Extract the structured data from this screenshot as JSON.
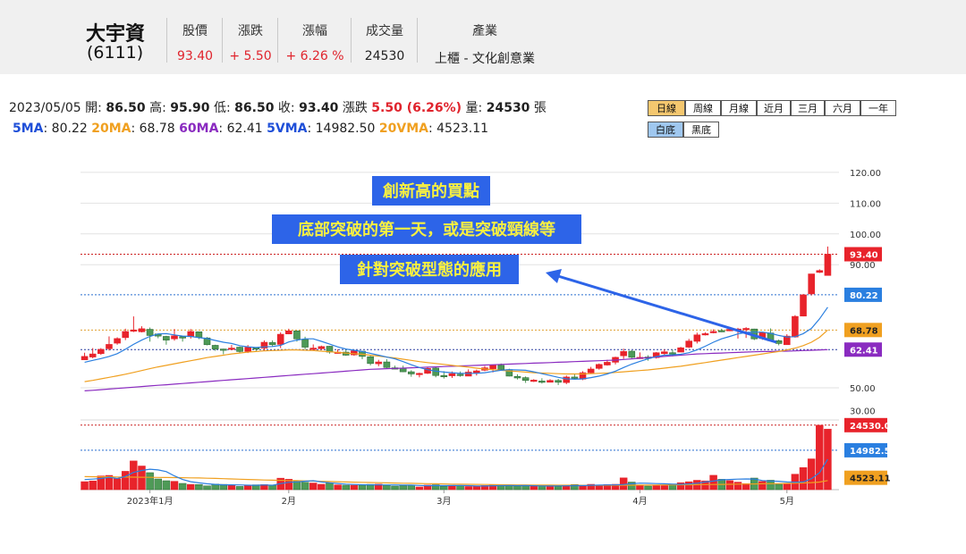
{
  "header": {
    "name": "大宇資",
    "code": "(6111)",
    "columns": [
      {
        "title": "股價",
        "value": "93.40",
        "color": "#e0242d"
      },
      {
        "title": "漲跌",
        "value": "+ 5.50",
        "color": "#e0242d"
      },
      {
        "title": "漲幅",
        "value": "+ 6.26 %",
        "color": "#e0242d"
      },
      {
        "title": "成交量",
        "value": "24530",
        "color": "#222222"
      },
      {
        "title": "產業",
        "value": "上櫃 - 文化創意業",
        "color": "#222222"
      }
    ]
  },
  "info": {
    "date": "2023/05/05",
    "open_label": "開:",
    "open": "86.50",
    "high_label": "高:",
    "high": "95.90",
    "low_label": "低:",
    "low": "86.50",
    "close_label": "收:",
    "close": "93.40",
    "chg_label": "漲跌",
    "chg": "5.50 (6.26%)",
    "vol_label": "量:",
    "vol": "24530",
    "vol_unit": "張",
    "ma5_label": "5MA",
    "ma5": ": 80.22",
    "ma20_label": "20MA",
    "ma20": ": 68.78",
    "ma60_label": "60MA",
    "ma60": ": 62.41",
    "vma5_label": "5VMA",
    "vma5": ": 14982.50",
    "vma20_label": "20VMA",
    "vma20": ": 4523.11"
  },
  "buttons": {
    "periods": [
      "日線",
      "周線",
      "月線",
      "近月",
      "三月",
      "六月",
      "一年"
    ],
    "themes": [
      "白底",
      "黑底"
    ]
  },
  "colors": {
    "up": "#e8232b",
    "down": "#4e9a57",
    "ma5": "#2a7fe0",
    "ma20": "#f0a020",
    "ma60": "#8a2bc0",
    "annotation_bg": "#2d64e8",
    "annotation_text": "#f8f040"
  },
  "annotations": [
    "創新高的買點",
    "底部突破的第一天，或是突破頸線等",
    "針對突破型態的應用"
  ],
  "chart_data": {
    "type": "candlestick",
    "price_axis": {
      "ticks": [
        "120.00",
        "110.00",
        "100.00",
        "90.00",
        "50.00"
      ],
      "values": [
        120,
        110,
        100,
        90,
        50
      ],
      "range": [
        41,
        122
      ]
    },
    "volume_axis": {
      "ticks": [
        "30.00"
      ],
      "values": [
        30
      ],
      "range": [
        0,
        26500
      ]
    },
    "x_labels": [
      "2023年1月",
      "2月",
      "3月",
      "4月",
      "5月"
    ],
    "x_label_positions": [
      8,
      25,
      44,
      68,
      86
    ],
    "n": 92,
    "candles": [
      [
        59.1,
        61.4,
        59.1,
        60.2,
        15.9
      ],
      [
        60.0,
        62.9,
        59.6,
        61.0,
        17.3
      ],
      [
        61.1,
        62.9,
        60.7,
        62.5,
        27.2
      ],
      [
        62.7,
        66.7,
        62.1,
        64.1,
        28.3
      ],
      [
        64.5,
        66.4,
        64.0,
        66.0,
        21.6
      ],
      [
        66.3,
        69.2,
        65.5,
        68.3,
        36.4
      ],
      [
        68.4,
        73.2,
        68.1,
        68.8,
        56.9
      ],
      [
        68.2,
        70.0,
        68.0,
        69.2,
        46.9
      ],
      [
        69.0,
        69.6,
        65.0,
        67.0,
        33.7
      ],
      [
        67.5,
        67.5,
        66.1,
        66.8,
        21.2
      ],
      [
        66.7,
        66.9,
        64.0,
        65.5,
        17.7
      ],
      [
        65.9,
        69.1,
        65.3,
        66.9,
        16.6
      ],
      [
        66.6,
        66.7,
        65.0,
        66.2,
        12.4
      ],
      [
        66.6,
        69.1,
        66.0,
        68.3,
        10.5
      ],
      [
        68.2,
        68.3,
        65.8,
        66.4,
        10.2
      ],
      [
        66.2,
        66.5,
        63.8,
        64.0,
        7.6
      ],
      [
        63.8,
        64.0,
        62.0,
        62.6,
        11.1
      ],
      [
        62.6,
        62.7,
        60.9,
        62.3,
        10.5
      ],
      [
        62.8,
        63.9,
        62.2,
        62.9,
        8.6
      ],
      [
        63.2,
        63.4,
        61.4,
        61.8,
        6.4
      ],
      [
        61.8,
        63.9,
        61.3,
        63.2,
        7.6
      ],
      [
        63.0,
        63.2,
        61.8,
        62.9,
        9.6
      ],
      [
        62.9,
        65.4,
        61.9,
        64.8,
        10.1
      ],
      [
        64.7,
        65.4,
        63.5,
        64.0,
        9.4
      ],
      [
        64.1,
        68.0,
        62.9,
        67.4,
        22.8
      ],
      [
        67.5,
        69.2,
        67.4,
        68.5,
        20.7
      ],
      [
        68.5,
        68.6,
        65.0,
        65.9,
        17.0
      ],
      [
        65.7,
        66.6,
        62.5,
        63.2,
        14.6
      ],
      [
        62.9,
        64.1,
        62.2,
        62.9,
        13.2
      ],
      [
        62.7,
        63.7,
        62.3,
        63.4,
        10.7
      ],
      [
        63.5,
        63.6,
        61.1,
        61.6,
        13.0
      ],
      [
        61.6,
        62.5,
        61.4,
        61.6,
        9.5
      ],
      [
        61.6,
        62.4,
        60.4,
        60.6,
        8.8
      ],
      [
        60.7,
        62.2,
        60.4,
        62.0,
        8.8
      ],
      [
        61.9,
        62.0,
        59.3,
        60.2,
        9.2
      ],
      [
        60.1,
        60.4,
        57.3,
        57.9,
        10.5
      ],
      [
        57.8,
        59.1,
        57.0,
        58.4,
        10.9
      ],
      [
        58.4,
        59.3,
        56.4,
        56.6,
        9.3
      ],
      [
        56.5,
        57.2,
        56.1,
        56.3,
        7.1
      ],
      [
        56.4,
        57.2,
        55.1,
        55.2,
        8.0
      ],
      [
        55.2,
        55.7,
        53.6,
        54.5,
        9.0
      ],
      [
        54.5,
        54.9,
        53.4,
        54.7,
        5.4
      ],
      [
        54.7,
        56.8,
        54.5,
        56.3,
        9.1
      ],
      [
        56.4,
        56.9,
        53.4,
        54.0,
        9.7
      ],
      [
        54.0,
        55.4,
        53.0,
        53.9,
        6.8
      ],
      [
        53.9,
        55.3,
        53.2,
        54.6,
        8.5
      ],
      [
        54.4,
        55.3,
        53.6,
        54.0,
        8.4
      ],
      [
        53.8,
        56.0,
        53.8,
        55.1,
        6.3
      ],
      [
        54.8,
        55.9,
        54.0,
        55.5,
        6.6
      ],
      [
        55.7,
        57.1,
        55.4,
        56.5,
        8.2
      ],
      [
        56.2,
        57.4,
        55.0,
        57.3,
        9.1
      ],
      [
        57.3,
        57.9,
        55.7,
        56.0,
        7.5
      ],
      [
        55.9,
        56.2,
        53.7,
        53.8,
        7.9
      ],
      [
        53.7,
        54.4,
        52.7,
        53.2,
        7.4
      ],
      [
        53.3,
        53.7,
        51.6,
        52.4,
        7.5
      ],
      [
        52.2,
        52.8,
        51.9,
        52.5,
        8.4
      ],
      [
        52.2,
        53.1,
        51.4,
        52.0,
        7.6
      ],
      [
        51.8,
        52.8,
        51.8,
        52.4,
        7.0
      ],
      [
        52.4,
        52.9,
        50.9,
        51.8,
        6.6
      ],
      [
        51.7,
        54.0,
        51.2,
        53.5,
        8.5
      ],
      [
        53.5,
        54.5,
        52.8,
        53.2,
        10.2
      ],
      [
        52.8,
        55.4,
        52.5,
        54.9,
        7.1
      ],
      [
        54.9,
        56.8,
        54.5,
        56.1,
        10.6
      ],
      [
        56.3,
        57.9,
        55.9,
        57.6,
        8.8
      ],
      [
        57.4,
        59.1,
        57.2,
        58.3,
        10.2
      ],
      [
        58.3,
        60.1,
        57.6,
        59.9,
        10.6
      ],
      [
        60.4,
        62.7,
        59.4,
        61.8,
        23.4
      ],
      [
        61.9,
        62.2,
        59.6,
        59.9,
        15.0
      ],
      [
        59.8,
        61.5,
        59.4,
        59.9,
        8.1
      ],
      [
        60.0,
        60.6,
        58.8,
        59.9,
        7.1
      ],
      [
        59.8,
        61.6,
        59.5,
        61.4,
        8.3
      ],
      [
        61.1,
        62.5,
        60.7,
        61.7,
        8.2
      ],
      [
        61.4,
        62.4,
        60.2,
        61.2,
        11.2
      ],
      [
        61.6,
        63.3,
        61.6,
        63.0,
        13.8
      ],
      [
        63.2,
        65.9,
        62.9,
        65.2,
        15.7
      ],
      [
        65.1,
        67.9,
        64.4,
        67.2,
        18.6
      ],
      [
        67.2,
        68.0,
        67.0,
        67.6,
        17.4
      ],
      [
        67.9,
        69.0,
        67.7,
        68.3,
        28.5
      ],
      [
        68.6,
        69.2,
        68.1,
        68.3,
        20.6
      ],
      [
        68.5,
        69.8,
        68.4,
        69.0,
        17.9
      ],
      [
        69.0,
        69.5,
        66.0,
        69.1,
        14.9
      ],
      [
        69.1,
        69.7,
        66.2,
        69.3,
        12.1
      ],
      [
        69.1,
        69.2,
        65.5,
        65.9,
        23.0
      ],
      [
        66.0,
        68.0,
        65.6,
        67.9,
        16.4
      ],
      [
        67.8,
        69.3,
        65.1,
        65.3,
        18.7
      ],
      [
        65.3,
        65.7,
        63.8,
        64.4,
        10.7
      ],
      [
        64.0,
        67.4,
        64.0,
        66.8,
        11.7
      ],
      [
        66.5,
        73.6,
        66.3,
        73.2,
        30.7
      ],
      [
        73.3,
        80.5,
        73.2,
        80.2,
        43.8
      ],
      [
        80.5,
        87.0,
        80.0,
        87.0,
        61.0
      ],
      [
        87.5,
        88.5,
        87.3,
        88.1,
        127.7
      ],
      [
        86.5,
        95.9,
        86.5,
        93.4,
        120.0
      ]
    ],
    "ma5": [
      58.3,
      58.9,
      59.5,
      60.2,
      61.1,
      62.5,
      64.1,
      65.5,
      66.7,
      67.5,
      67.6,
      67.2,
      66.8,
      66.7,
      66.3,
      66.0,
      65.4,
      64.8,
      64.4,
      63.7,
      63.3,
      63.1,
      63.3,
      63.4,
      63.8,
      64.9,
      65.5,
      65.9,
      65.9,
      65.1,
      64.2,
      63.3,
      62.6,
      62.2,
      61.8,
      61.2,
      60.6,
      60.0,
      59.4,
      58.5,
      57.5,
      56.6,
      55.9,
      55.4,
      55.1,
      54.9,
      54.7,
      54.7,
      54.7,
      54.9,
      55.3,
      55.7,
      55.9,
      55.8,
      55.7,
      55.2,
      54.6,
      54.0,
      53.4,
      52.9,
      52.8,
      52.9,
      53.3,
      53.8,
      54.5,
      55.4,
      56.6,
      57.7,
      58.6,
      59.4,
      60.2,
      60.6,
      60.7,
      60.9,
      61.4,
      62.3,
      63.5,
      64.8,
      65.9,
      66.7,
      67.5,
      68.0,
      68.1,
      68.1,
      67.7,
      67.0,
      66.5,
      66.6,
      67.6,
      69.3,
      72.4,
      76.2
    ],
    "ma20": [
      52.0,
      52.4,
      52.9,
      53.4,
      53.9,
      54.4,
      55.0,
      55.6,
      56.2,
      56.8,
      57.3,
      57.8,
      58.3,
      58.8,
      59.3,
      59.8,
      60.2,
      60.6,
      61.0,
      61.3,
      61.6,
      61.8,
      62.0,
      62.1,
      62.2,
      62.3,
      62.3,
      62.2,
      62.1,
      61.9,
      61.7,
      61.5,
      61.3,
      61.1,
      60.9,
      60.6,
      60.3,
      60.0,
      59.7,
      59.3,
      58.9,
      58.5,
      58.2,
      57.9,
      57.6,
      57.3,
      57.0,
      56.7,
      56.4,
      56.1,
      55.9,
      55.7,
      55.5,
      55.3,
      55.1,
      54.9,
      54.8,
      54.7,
      54.6,
      54.5,
      54.5,
      54.5,
      54.6,
      54.7,
      54.8,
      55.0,
      55.2,
      55.4,
      55.6,
      55.8,
      56.1,
      56.4,
      56.7,
      57.0,
      57.4,
      57.8,
      58.2,
      58.6,
      59.0,
      59.4,
      59.8,
      60.2,
      60.6,
      61.0,
      61.4,
      61.8,
      62.3,
      62.9,
      63.7,
      64.8,
      66.4,
      68.78
    ],
    "ma60": [
      49.0,
      49.2,
      49.4,
      49.6,
      49.8,
      50.0,
      50.2,
      50.4,
      50.6,
      50.8,
      51.0,
      51.2,
      51.4,
      51.6,
      51.8,
      52.0,
      52.2,
      52.4,
      52.6,
      52.8,
      53.0,
      53.2,
      53.4,
      53.6,
      53.8,
      54.0,
      54.2,
      54.4,
      54.6,
      54.8,
      55.0,
      55.2,
      55.4,
      55.6,
      55.8,
      56.0,
      56.1,
      56.2,
      56.3,
      56.4,
      56.5,
      56.6,
      56.7,
      56.8,
      56.9,
      57.0,
      57.1,
      57.2,
      57.3,
      57.4,
      57.5,
      57.6,
      57.7,
      57.8,
      57.9,
      58.0,
      58.1,
      58.2,
      58.3,
      58.4,
      58.5,
      58.6,
      58.7,
      58.8,
      58.9,
      59.0,
      59.2,
      59.4,
      59.6,
      59.8,
      60.0,
      60.2,
      60.4,
      60.6,
      60.8,
      61.0,
      61.1,
      61.2,
      61.3,
      61.4,
      61.5,
      61.6,
      61.7,
      61.8,
      61.8,
      61.9,
      61.9,
      62.0,
      62.1,
      62.2,
      62.3,
      62.41
    ],
    "vma5": [
      20.0,
      20.8,
      22.2,
      24.5,
      22.1,
      26.2,
      34.1,
      38.0,
      40.6,
      39.1,
      35.7,
      27.2,
      20.2,
      15.7,
      13.5,
      11.7,
      10.4,
      9.6,
      9.6,
      9.3,
      8.8,
      8.6,
      9.3,
      8.6,
      12.1,
      14.5,
      15.4,
      16.8,
      17.7,
      15.2,
      13.7,
      12.2,
      11.0,
      10.3,
      9.7,
      9.6,
      9.4,
      9.3,
      9.4,
      9.2,
      9.1,
      8.3,
      7.8,
      8.1,
      8.0,
      8.2,
      8.3,
      7.9,
      7.3,
      7.2,
      7.7,
      8.0,
      8.2,
      7.9,
      8.1,
      7.7,
      7.4,
      7.2,
      7.5,
      7.6,
      8.0,
      7.9,
      8.6,
      9.0,
      9.4,
      9.3,
      10.3,
      11.7,
      12.9,
      12.6,
      12.0,
      11.6,
      11.0,
      10.7,
      11.4,
      12.7,
      15.2,
      17.0,
      19.4,
      20.1,
      20.8,
      21.3,
      21.0,
      18.0,
      17.2,
      16.7,
      15.2,
      14.9,
      15.3,
      21.7,
      33.6,
      60.4
    ],
    "vma20": [
      25.8,
      25.7,
      25.5,
      25.4,
      25.2,
      25.0,
      24.8,
      24.6,
      24.5,
      24.3,
      24.1,
      23.9,
      23.7,
      23.4,
      23.1,
      22.7,
      22.3,
      21.8,
      21.3,
      20.7,
      20.1,
      19.6,
      19.1,
      18.7,
      18.4,
      18.1,
      17.8,
      17.3,
      16.9,
      16.5,
      16.1,
      15.7,
      15.3,
      14.9,
      14.5,
      14.2,
      13.8,
      13.4,
      13.1,
      12.8,
      12.5,
      12.2,
      11.9,
      11.6,
      11.3,
      11.0,
      10.8,
      10.6,
      10.4,
      10.2,
      10.0,
      9.8,
      9.6,
      9.4,
      9.3,
      9.2,
      9.1,
      9.0,
      8.9,
      8.8,
      8.8,
      8.7,
      8.7,
      8.7,
      8.7,
      8.7,
      8.8,
      8.9,
      9.0,
      9.1,
      9.2,
      9.3,
      9.4,
      9.5,
      9.7,
      9.9,
      10.1,
      10.3,
      10.5,
      10.7,
      10.9,
      11.1,
      11.4,
      11.7,
      11.9,
      12.1,
      12.4,
      12.8,
      13.3,
      14.0,
      15.1,
      18.09
    ],
    "price_labels": [
      {
        "value": 93.4,
        "text": "93.40",
        "color": "#e8232b"
      },
      {
        "value": 80.22,
        "text": "80.22",
        "color": "#2a7fe0"
      },
      {
        "value": 68.78,
        "text": "68.78",
        "color": "#f0a020"
      },
      {
        "value": 62.41,
        "text": "62.41",
        "color": "#8a2bc0"
      }
    ],
    "volume_labels": [
      {
        "value": 24530,
        "text": "24530.00",
        "color": "#e8232b"
      },
      {
        "value": 14982.5,
        "text": "14982.50",
        "color": "#2a7fe0"
      },
      {
        "value": 4523.11,
        "text": "4523.11",
        "color": "#f0a020"
      }
    ]
  }
}
